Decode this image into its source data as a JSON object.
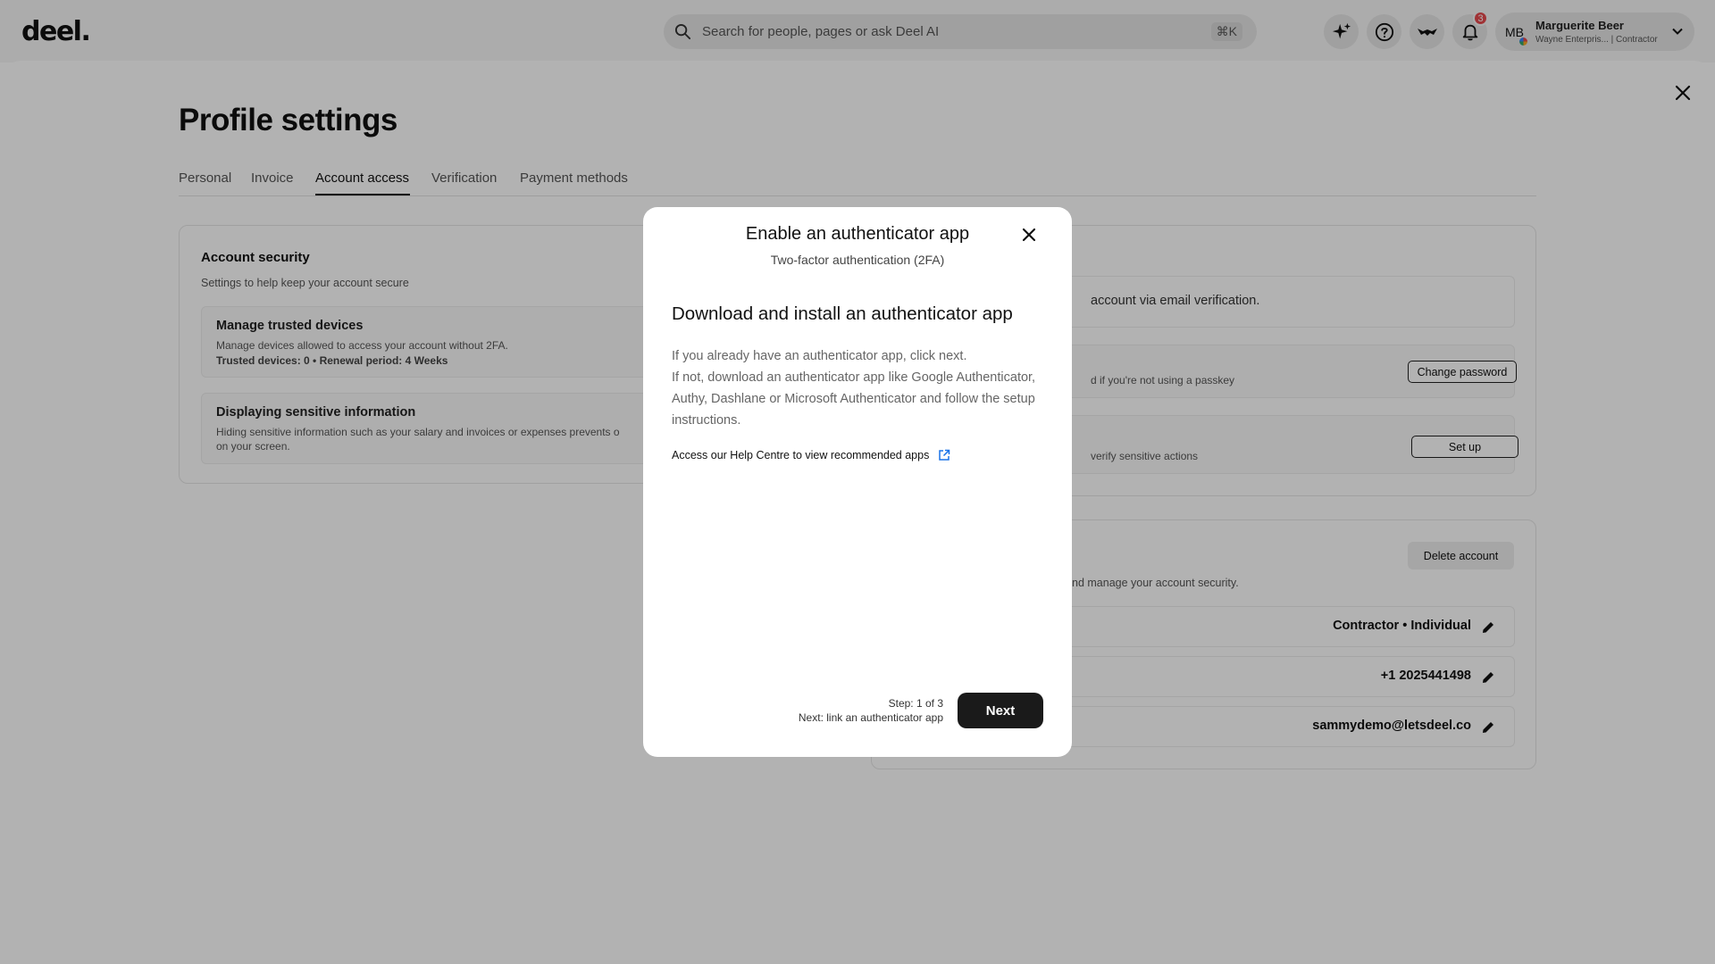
{
  "topbar": {
    "logo": "deel.",
    "search_placeholder": "Search for people, pages or ask Deel AI",
    "search_shortcut": "⌘K",
    "notification_count": "3",
    "user": {
      "initials": "MB",
      "name": "Marguerite Beer",
      "subtitle": "Wayne Enterpris... | Contractor"
    }
  },
  "page": {
    "title": "Profile settings",
    "tabs": [
      {
        "label": "Personal"
      },
      {
        "label": "Invoice"
      },
      {
        "label": "Account access"
      },
      {
        "label": "Verification"
      },
      {
        "label": "Payment methods"
      }
    ],
    "active_tab": "Account access"
  },
  "security_card": {
    "title": "Account security",
    "subtitle": "Settings to help keep your account secure",
    "trusted": {
      "title": "Manage trusted devices",
      "desc": "Manage devices allowed to access your account without 2FA.",
      "meta": "Trusted devices: 0 • Renewal period: 4 Weeks"
    },
    "sensitive": {
      "title": "Displaying sensitive information",
      "desc": "Hiding sensitive information such as your salary and invoices or expenses prevents o",
      "desc2": "on your screen."
    }
  },
  "right_card": {
    "email_note": "account via email verification.",
    "password_note": "d if you're not using a passkey",
    "change_password": "Change password",
    "twofa_note": "verify sensitive actions",
    "setup": "Set up"
  },
  "account_card": {
    "delete_button": "Delete account",
    "note": "nd manage your account security.",
    "rows": [
      {
        "value": "Contractor • Individual"
      },
      {
        "value": "+1 2025441498"
      },
      {
        "value": "sammydemo@letsdeel.co"
      }
    ]
  },
  "modal": {
    "title": "Enable an authenticator app",
    "subtitle": "Two-factor authentication (2FA)",
    "heading": "Download and install an authenticator app",
    "para1": "If you already have an authenticator app, click next.",
    "para2": "If not, download an authenticator app like Google Authenticator, Authy, Dashlane or Microsoft Authenticator and follow the setup instructions.",
    "help_link": "Access our Help Centre to view recommended apps",
    "step": "Step: 1 of 3",
    "next_step": "Next: link an authenticator app",
    "next_button": "Next"
  }
}
